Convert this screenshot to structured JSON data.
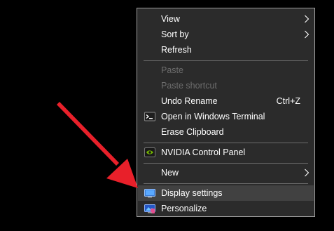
{
  "menu": {
    "items": {
      "view": {
        "label": "View",
        "submenu": true
      },
      "sort_by": {
        "label": "Sort by",
        "submenu": true
      },
      "refresh": {
        "label": "Refresh"
      },
      "paste": {
        "label": "Paste",
        "disabled": true
      },
      "paste_shortcut": {
        "label": "Paste shortcut",
        "disabled": true
      },
      "undo_rename": {
        "label": "Undo Rename",
        "shortcut": "Ctrl+Z"
      },
      "open_terminal": {
        "label": "Open in Windows Terminal",
        "icon": "terminal-icon"
      },
      "erase_clipboard": {
        "label": "Erase Clipboard"
      },
      "nvidia": {
        "label": "NVIDIA Control Panel",
        "icon": "nvidia-icon"
      },
      "new": {
        "label": "New",
        "submenu": true
      },
      "display_settings": {
        "label": "Display settings",
        "icon": "display-icon",
        "highlighted": true
      },
      "personalize": {
        "label": "Personalize",
        "icon": "personalize-icon"
      }
    }
  },
  "colors": {
    "menu_background": "#2b2b2b",
    "menu_border": "#a0a0a0",
    "hover_background": "#414141",
    "text": "#ffffff",
    "disabled_text": "#6d6d6d",
    "arrow": "#e8202a"
  }
}
